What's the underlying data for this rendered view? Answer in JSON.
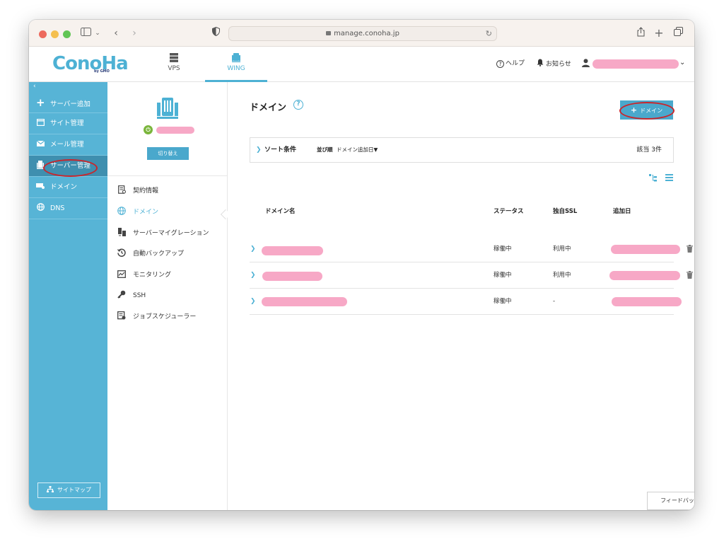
{
  "browser": {
    "url": "manage.conoha.jp"
  },
  "header": {
    "logo_text": "ConoHa",
    "logo_sub": "by GMO",
    "tabs": [
      {
        "label": "VPS",
        "icon": "server-stack-icon"
      },
      {
        "label": "WING",
        "icon": "wing-server-icon"
      }
    ],
    "help_label": "ヘルプ",
    "notice_label": "お知らせ"
  },
  "sidebar": {
    "collapse_glyph": "‹",
    "items": [
      {
        "label": "サーバー追加",
        "icon": "plus-icon"
      },
      {
        "label": "サイト管理",
        "icon": "window-icon"
      },
      {
        "label": "メール管理",
        "icon": "mail-icon"
      },
      {
        "label": "サーバー管理",
        "icon": "server-icon"
      },
      {
        "label": "ドメイン",
        "icon": "domain-icon"
      },
      {
        "label": "DNS",
        "icon": "globe-icon"
      }
    ],
    "sitemap_label": "サイトマップ"
  },
  "subsidebar": {
    "switch_label": "切り替え",
    "menu": [
      {
        "label": "契約情報",
        "icon": "contract-icon"
      },
      {
        "label": "ドメイン",
        "icon": "www-icon"
      },
      {
        "label": "サーバーマイグレーション",
        "icon": "migration-icon"
      },
      {
        "label": "自動バックアップ",
        "icon": "backup-icon"
      },
      {
        "label": "モニタリング",
        "icon": "monitoring-icon"
      },
      {
        "label": "SSH",
        "icon": "key-icon"
      },
      {
        "label": "ジョブスケジューラー",
        "icon": "scheduler-icon"
      }
    ]
  },
  "main": {
    "title": "ドメイン",
    "add_button": "ドメイン",
    "sort": {
      "label": "ソート条件",
      "key": "並び順",
      "value": "ドメイン追加日▼"
    },
    "count": "該当 3件",
    "columns": [
      "ドメイン名",
      "ステータス",
      "独自SSL",
      "追加日"
    ],
    "rows": [
      {
        "status": "稼働中",
        "ssl": "利用中"
      },
      {
        "status": "稼働中",
        "ssl": "利用中"
      },
      {
        "status": "稼働中",
        "ssl": "-"
      }
    ],
    "feedback_label": "フィードバック"
  },
  "colors": {
    "accent": "#4db1d4",
    "sidebar": "#57b4d6",
    "button": "#4aa8cc",
    "redaction": "#f7a8c6",
    "annotation": "#c9262c",
    "status_online": "#7ab53b"
  }
}
